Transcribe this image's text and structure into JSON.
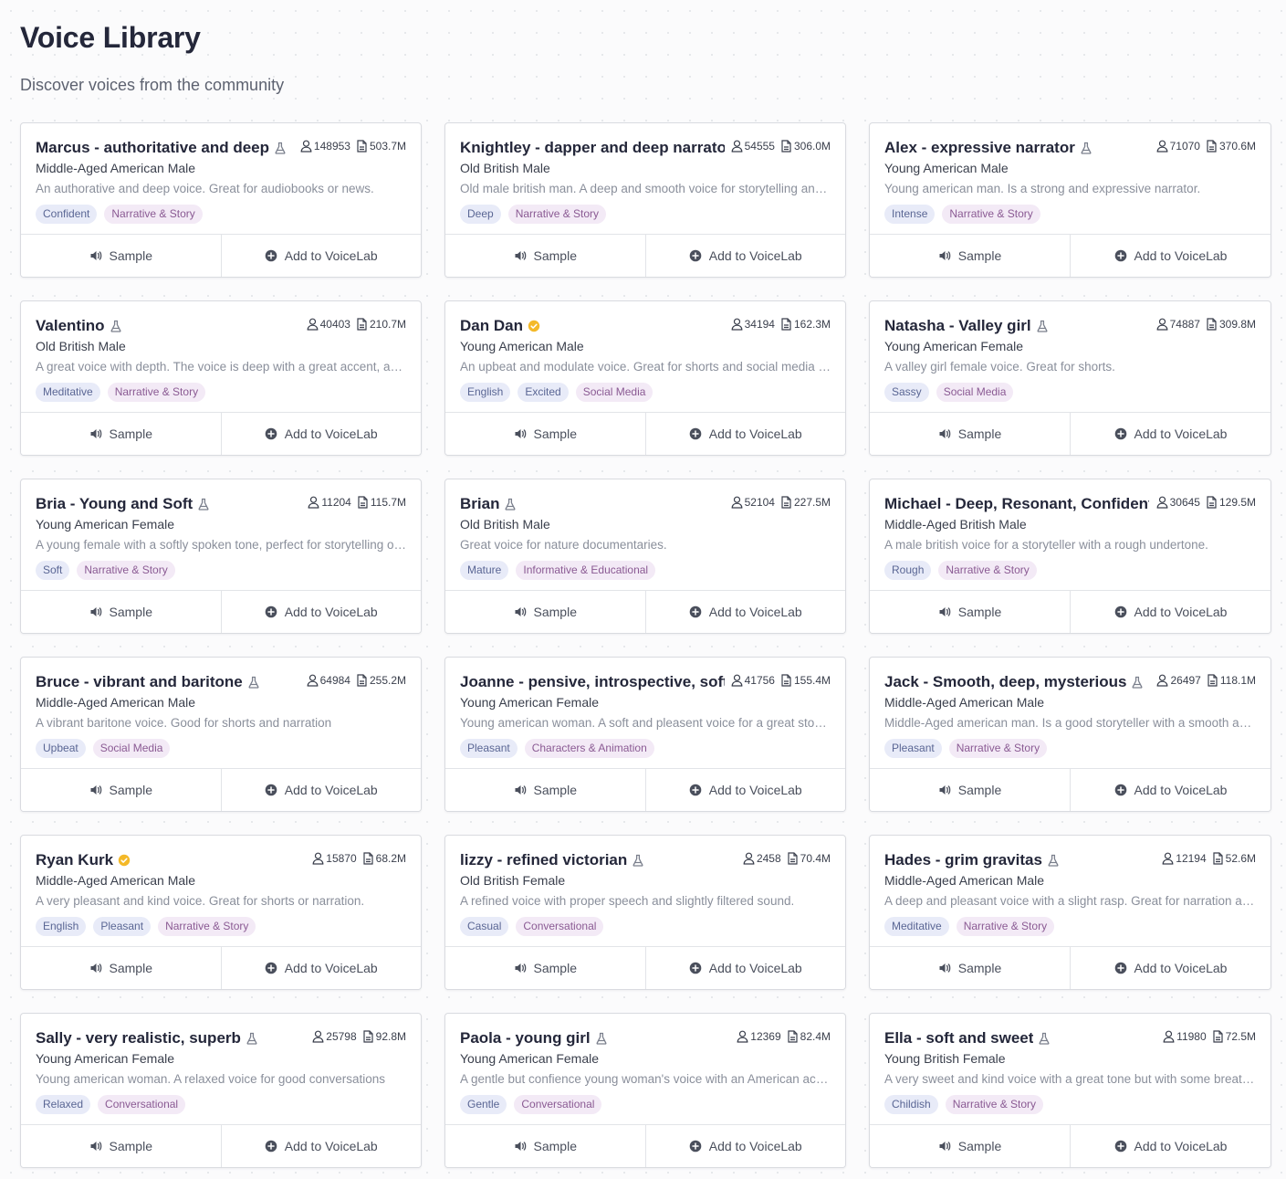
{
  "header": {
    "title": "Voice Library",
    "subtitle": "Discover voices from the community"
  },
  "actions": {
    "sample_label": "Sample",
    "add_label": "Add to VoiceLab"
  },
  "voices": [
    {
      "name": "Marcus - authoritative and deep",
      "badge": "flask",
      "users": "148953",
      "chars": "503.7M",
      "meta": "Middle-Aged American Male",
      "desc": "An authorative and deep voice. Great for audiobooks or news.",
      "tags": [
        "Confident",
        "Narrative & Story"
      ]
    },
    {
      "name": "Knightley - dapper and deep narrator",
      "badge": "none",
      "users": "54555",
      "chars": "306.0M",
      "meta": "Old British Male",
      "desc": "Old male british man. A deep and smooth voice for storytelling and podcast.",
      "tags": [
        "Deep",
        "Narrative & Story"
      ]
    },
    {
      "name": "Alex - expressive narrator",
      "badge": "flask",
      "users": "71070",
      "chars": "370.6M",
      "meta": "Young American Male",
      "desc": "Young american man. Is a strong and expressive narrator.",
      "tags": [
        "Intense",
        "Narrative & Story"
      ]
    },
    {
      "name": "Valentino",
      "badge": "flask",
      "users": "40403",
      "chars": "210.7M",
      "meta": "Old British Male",
      "desc": "A great voice with depth. The voice is deep with a great accent, and works well for meditations.",
      "tags": [
        "Meditative",
        "Narrative & Story"
      ]
    },
    {
      "name": "Dan Dan",
      "badge": "verified",
      "users": "34194",
      "chars": "162.3M",
      "meta": "Young American Male",
      "desc": "An upbeat and modulate voice. Great for shorts and social media content.",
      "tags": [
        "English",
        "Excited",
        "Social Media"
      ]
    },
    {
      "name": "Natasha - Valley girl",
      "badge": "flask",
      "users": "74887",
      "chars": "309.8M",
      "meta": "Young American Female",
      "desc": "A valley girl female voice. Great for shorts.",
      "tags": [
        "Sassy",
        "Social Media"
      ]
    },
    {
      "name": "Bria - Young and Soft",
      "badge": "flask",
      "users": "11204",
      "chars": "115.7M",
      "meta": "Young American Female",
      "desc": "A young female with a softly spoken tone, perfect for storytelling or ASMR.",
      "tags": [
        "Soft",
        "Narrative & Story"
      ]
    },
    {
      "name": "Brian",
      "badge": "flask",
      "users": "52104",
      "chars": "227.5M",
      "meta": "Old British Male",
      "desc": "Great voice for nature documentaries.",
      "tags": [
        "Mature",
        "Informative & Educational"
      ]
    },
    {
      "name": "Michael - Deep, Resonant, Confident",
      "badge": "none",
      "users": "30645",
      "chars": "129.5M",
      "meta": "Middle-Aged British Male",
      "desc": "A male british voice for a storyteller with a rough undertone.",
      "tags": [
        "Rough",
        "Narrative & Story"
      ]
    },
    {
      "name": "Bruce - vibrant and baritone",
      "badge": "flask",
      "users": "64984",
      "chars": "255.2M",
      "meta": "Middle-Aged American Male",
      "desc": "A vibrant baritone voice. Good for shorts and narration",
      "tags": [
        "Upbeat",
        "Social Media"
      ]
    },
    {
      "name": "Joanne - pensive, introspective, soft",
      "badge": "none",
      "users": "41756",
      "chars": "155.4M",
      "meta": "Young American Female",
      "desc": "Young american woman. A soft and pleasent voice for a great storytelling experience.",
      "tags": [
        "Pleasant",
        "Characters & Animation"
      ]
    },
    {
      "name": "Jack - Smooth, deep, mysterious",
      "badge": "flask",
      "users": "26497",
      "chars": "118.1M",
      "meta": "Middle-Aged American Male",
      "desc": "Middle-Aged american man. Is a good storyteller with a smooth and deep voice.",
      "tags": [
        "Pleasant",
        "Narrative & Story"
      ]
    },
    {
      "name": "Ryan Kurk",
      "badge": "verified",
      "users": "15870",
      "chars": "68.2M",
      "meta": "Middle-Aged American Male",
      "desc": "A very pleasant and kind voice. Great for shorts or narration.",
      "tags": [
        "English",
        "Pleasant",
        "Narrative & Story"
      ]
    },
    {
      "name": "lizzy - refined victorian",
      "badge": "flask",
      "users": "2458",
      "chars": "70.4M",
      "meta": "Old British Female",
      "desc": "A refined voice with proper speech and slightly filtered sound.",
      "tags": [
        "Casual",
        "Conversational"
      ]
    },
    {
      "name": "Hades - grim gravitas",
      "badge": "flask",
      "users": "12194",
      "chars": "52.6M",
      "meta": "Middle-Aged American Male",
      "desc": "A deep and pleasant voice with a slight rasp. Great for narration and audiobooks.",
      "tags": [
        "Meditative",
        "Narrative & Story"
      ]
    },
    {
      "name": "Sally - very realistic, superb",
      "badge": "flask",
      "users": "25798",
      "chars": "92.8M",
      "meta": "Young American Female",
      "desc": "Young american woman. A relaxed voice for good conversations",
      "tags": [
        "Relaxed",
        "Conversational"
      ]
    },
    {
      "name": "Paola - young girl",
      "badge": "flask",
      "users": "12369",
      "chars": "82.4M",
      "meta": "Young American Female",
      "desc": "A gentle but confience young woman's voice with an American accent.",
      "tags": [
        "Gentle",
        "Conversational"
      ]
    },
    {
      "name": "Ella - soft and sweet",
      "badge": "flask",
      "users": "11980",
      "chars": "72.5M",
      "meta": "Young British Female",
      "desc": "A very sweet and kind voice with a great tone but with some breathiness.",
      "tags": [
        "Childish",
        "Narrative & Story"
      ]
    }
  ]
}
